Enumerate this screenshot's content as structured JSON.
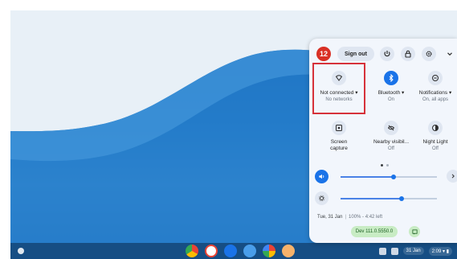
{
  "colors": {
    "accent": "#1a73e8",
    "avatar_bg": "#d93025",
    "highlight": "#d6323a",
    "version_bg": "#c8ecc4"
  },
  "header": {
    "avatar_text": "12",
    "sign_out_label": "Sign out",
    "buttons": [
      "power-icon",
      "lock-icon",
      "settings-icon",
      "chevron-down-icon"
    ]
  },
  "tiles": [
    {
      "icon": "wifi-icon",
      "label": "Not connected",
      "sub": "No networks",
      "dropdown": true
    },
    {
      "icon": "bluetooth-icon",
      "label": "Bluetooth",
      "sub": "On",
      "dropdown": true
    },
    {
      "icon": "notifications-icon",
      "label": "Notifications",
      "sub": "On, all apps",
      "dropdown": true
    },
    {
      "icon": "screen-capture-icon",
      "label": "Screen",
      "label2": "capture",
      "sub": ""
    },
    {
      "icon": "nearby-visibility-icon",
      "label": "Nearby visibil...",
      "sub": "Off"
    },
    {
      "icon": "night-light-icon",
      "label": "Night Light",
      "sub": "Off"
    }
  ],
  "sliders": {
    "volume_level": 0.55,
    "brightness_level": 0.63
  },
  "footer": {
    "date": "Tue, 31 Jan",
    "battery": "100% - 4:42 left",
    "version": "Dev 111.0.5550.0"
  },
  "shelf": {
    "date": "31 Jan",
    "time": "2:09"
  }
}
